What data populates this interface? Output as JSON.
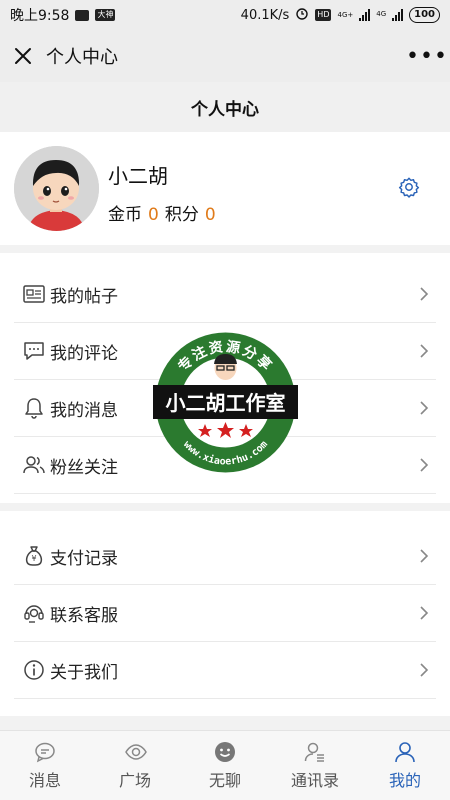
{
  "status_bar": {
    "time": "晚上9:58",
    "app_badge": "大神",
    "network_speed": "40.1K/s",
    "hd_label": "HD",
    "net_label_1": "4G+",
    "net_label_2": "4G",
    "battery": "100"
  },
  "nav": {
    "title": "个人中心",
    "more": "•••"
  },
  "header": {
    "title": "个人中心"
  },
  "profile": {
    "username": "小二胡",
    "coins_label": "金币",
    "coins_value": "0",
    "points_label": "积分",
    "points_value": "0"
  },
  "menu_group_1": [
    {
      "label": "我的帖子",
      "icon": "post-icon"
    },
    {
      "label": "我的评论",
      "icon": "comment-icon"
    },
    {
      "label": "我的消息",
      "icon": "bell-icon"
    },
    {
      "label": "粉丝关注",
      "icon": "fans-icon"
    }
  ],
  "menu_group_2": [
    {
      "label": "支付记录",
      "icon": "money-bag-icon"
    },
    {
      "label": "联系客服",
      "icon": "headset-icon"
    },
    {
      "label": "关于我们",
      "icon": "info-icon"
    }
  ],
  "watermark": {
    "top_text": "专注资源分享",
    "main_text": "小二胡工作室",
    "url_text": "www.xiaoerhu.com"
  },
  "tabs": [
    {
      "label": "消息",
      "icon": "message-icon",
      "active": false
    },
    {
      "label": "广场",
      "icon": "eye-icon",
      "active": false
    },
    {
      "label": "无聊",
      "icon": "smile-icon",
      "active": false
    },
    {
      "label": "通讯录",
      "icon": "contacts-icon",
      "active": false
    },
    {
      "label": "我的",
      "icon": "person-icon",
      "active": true
    }
  ],
  "colors": {
    "accent": "#2a63b8",
    "number_orange": "#e07b1a",
    "watermark_green": "#2b7a2f",
    "watermark_red": "#d42020"
  }
}
